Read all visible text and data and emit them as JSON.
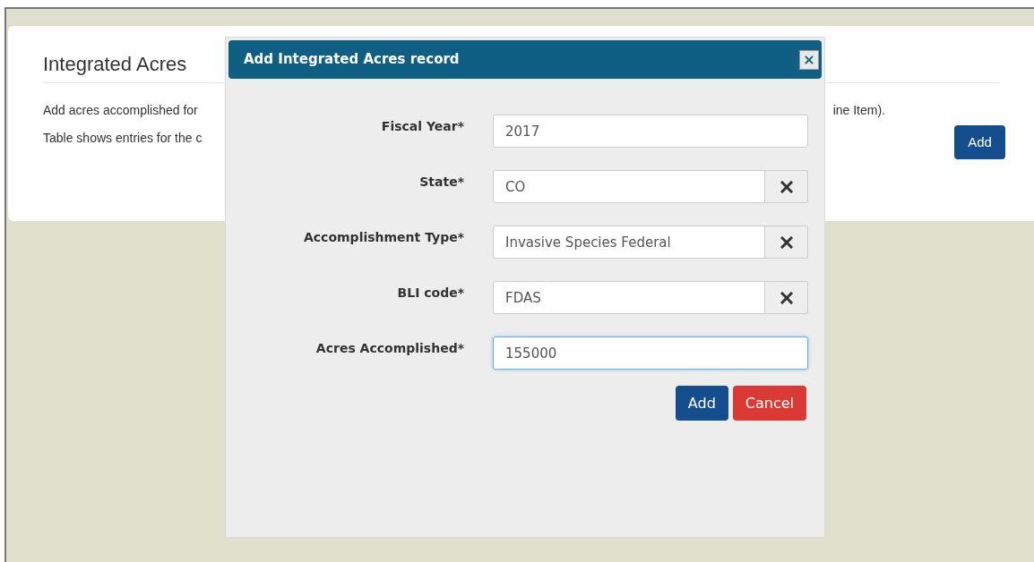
{
  "page": {
    "title": "Integrated Acres",
    "line_1_start": "Add acres accomplished for",
    "line_1_end": "ine Item).",
    "line_2_start": "Table shows entries for the c",
    "add_button": "Add"
  },
  "dialog": {
    "title": "Add Integrated Acres record",
    "close": "×",
    "fields": [
      {
        "kind": "text",
        "label": "Fiscal Year*",
        "value": "2017",
        "focused": false
      },
      {
        "kind": "clearable",
        "label": "State*",
        "value": "CO",
        "focused": false
      },
      {
        "kind": "clearable",
        "label": "Accomplishment Type*",
        "value": "Invasive Species Federal",
        "focused": false
      },
      {
        "kind": "clearable",
        "label": "BLI code*",
        "value": "FDAS",
        "focused": false
      },
      {
        "kind": "text",
        "label": "Acres Accomplished*",
        "value": "155000",
        "focused": true
      }
    ],
    "buttons": [
      {
        "kind": "primary",
        "label": "Add"
      },
      {
        "kind": "danger",
        "label": "Cancel"
      }
    ]
  }
}
